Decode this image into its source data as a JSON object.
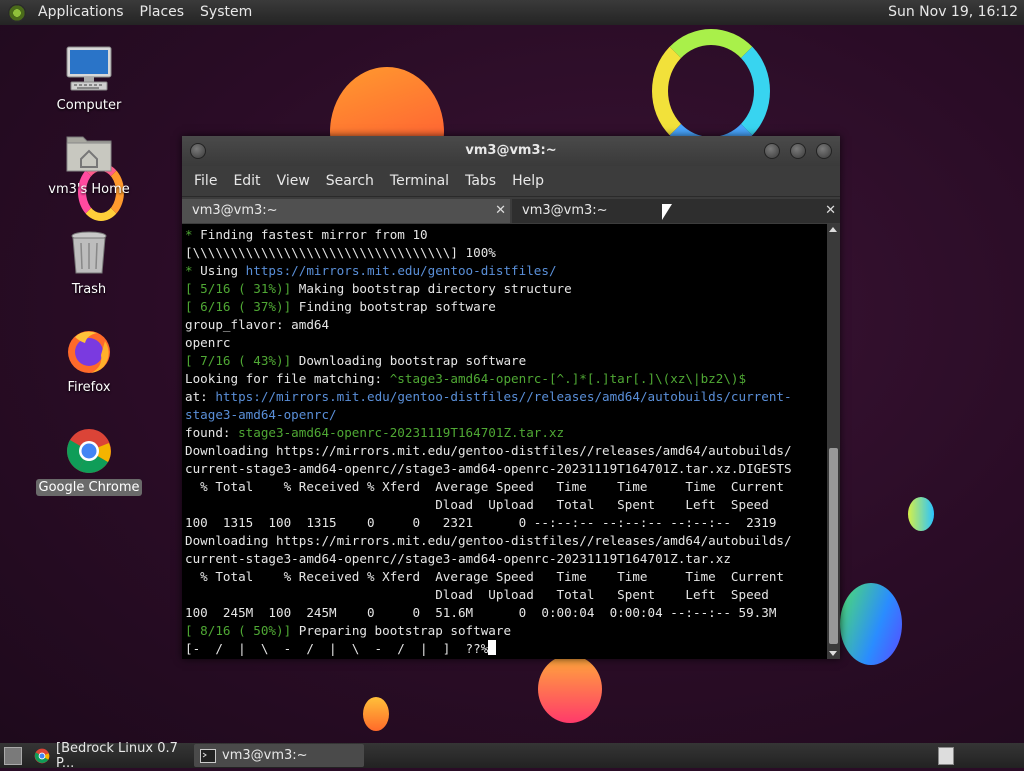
{
  "top_panel": {
    "menus": [
      "Applications",
      "Places",
      "System"
    ],
    "clock": "Sun Nov 19, 16:12"
  },
  "desktop_icons": [
    {
      "label": "Computer",
      "icon": "computer-icon"
    },
    {
      "label": "vm3's Home",
      "icon": "home-folder-icon"
    },
    {
      "label": "Trash",
      "icon": "trash-icon"
    },
    {
      "label": "Firefox",
      "icon": "firefox-icon"
    },
    {
      "label": "Google Chrome",
      "icon": "chrome-icon",
      "selected": true
    }
  ],
  "terminal": {
    "title": "vm3@vm3:~",
    "menu": [
      "File",
      "Edit",
      "View",
      "Search",
      "Terminal",
      "Tabs",
      "Help"
    ],
    "tabs": [
      {
        "label": "vm3@vm3:~",
        "active": true
      },
      {
        "label": "vm3@vm3:~",
        "active": false
      }
    ],
    "lines": [
      [
        [
          "g",
          "* "
        ],
        [
          "",
          "Finding fastest mirror from 10"
        ]
      ],
      [
        [
          "",
          "[\\\\\\\\\\\\\\\\\\\\\\\\\\\\\\\\\\\\\\\\\\\\\\\\\\\\\\\\\\\\\\\\\\\\] 100%"
        ]
      ],
      [
        [
          "g",
          "* "
        ],
        [
          "",
          "Using "
        ],
        [
          "b",
          "https://mirrors.mit.edu/gentoo-distfiles/"
        ]
      ],
      [
        [
          "g",
          "[ 5/16 ( 31%)]"
        ],
        [
          "",
          " Making bootstrap directory structure"
        ]
      ],
      [
        [
          "g",
          "[ 6/16 ( 37%)]"
        ],
        [
          "",
          " Finding bootstrap software"
        ]
      ],
      [
        [
          "",
          "group_flavor: amd64"
        ]
      ],
      [
        [
          "",
          "openrc"
        ]
      ],
      [
        [
          "g",
          "[ 7/16 ( 43%)]"
        ],
        [
          "",
          " Downloading bootstrap software"
        ]
      ],
      [
        [
          "",
          "Looking for file matching: "
        ],
        [
          "g",
          "^stage3-amd64-openrc-[^.]*[.]tar[.]\\(xz\\|bz2\\)$"
        ]
      ],
      [
        [
          "",
          "at: "
        ],
        [
          "b",
          "https://mirrors.mit.edu/gentoo-distfiles//releases/amd64/autobuilds/current-"
        ]
      ],
      [
        [
          "b",
          "stage3-amd64-openrc/"
        ]
      ],
      [
        [
          "",
          "found: "
        ],
        [
          "g",
          "stage3-amd64-openrc-20231119T164701Z.tar.xz"
        ]
      ],
      [
        [
          "",
          "Downloading https://mirrors.mit.edu/gentoo-distfiles//releases/amd64/autobuilds/"
        ]
      ],
      [
        [
          "",
          "current-stage3-amd64-openrc//stage3-amd64-openrc-20231119T164701Z.tar.xz.DIGESTS"
        ]
      ],
      [
        [
          "",
          "  % Total    % Received % Xferd  Average Speed   Time    Time     Time  Current"
        ]
      ],
      [
        [
          "",
          "                                 Dload  Upload   Total   Spent    Left  Speed"
        ]
      ],
      [
        [
          "",
          "100  1315  100  1315    0     0   2321      0 --:--:-- --:--:-- --:--:--  2319"
        ]
      ],
      [
        [
          "",
          "Downloading https://mirrors.mit.edu/gentoo-distfiles//releases/amd64/autobuilds/"
        ]
      ],
      [
        [
          "",
          "current-stage3-amd64-openrc//stage3-amd64-openrc-20231119T164701Z.tar.xz"
        ]
      ],
      [
        [
          "",
          "  % Total    % Received % Xferd  Average Speed   Time    Time     Time  Current"
        ]
      ],
      [
        [
          "",
          "                                 Dload  Upload   Total   Spent    Left  Speed"
        ]
      ],
      [
        [
          "",
          "100  245M  100  245M    0     0  51.6M      0  0:00:04  0:00:04 --:--:-- 59.3M"
        ]
      ],
      [
        [
          "g",
          "[ 8/16 ( 50%)]"
        ],
        [
          "",
          " Preparing bootstrap software"
        ]
      ],
      [
        [
          "",
          "[-  /  |  \\  -  /  |  \\  -  /  |  ]  ??%"
        ]
      ]
    ]
  },
  "taskbar": {
    "tasks": [
      {
        "label": "[Bedrock Linux 0.7 P...",
        "icon": "chrome-icon"
      },
      {
        "label": "vm3@vm3:~",
        "icon": "terminal-icon",
        "active": true
      }
    ]
  },
  "colors": {
    "terminal_green": "#4fa834",
    "terminal_blue": "#5a8fd8",
    "panel": "#2e2e2e"
  }
}
